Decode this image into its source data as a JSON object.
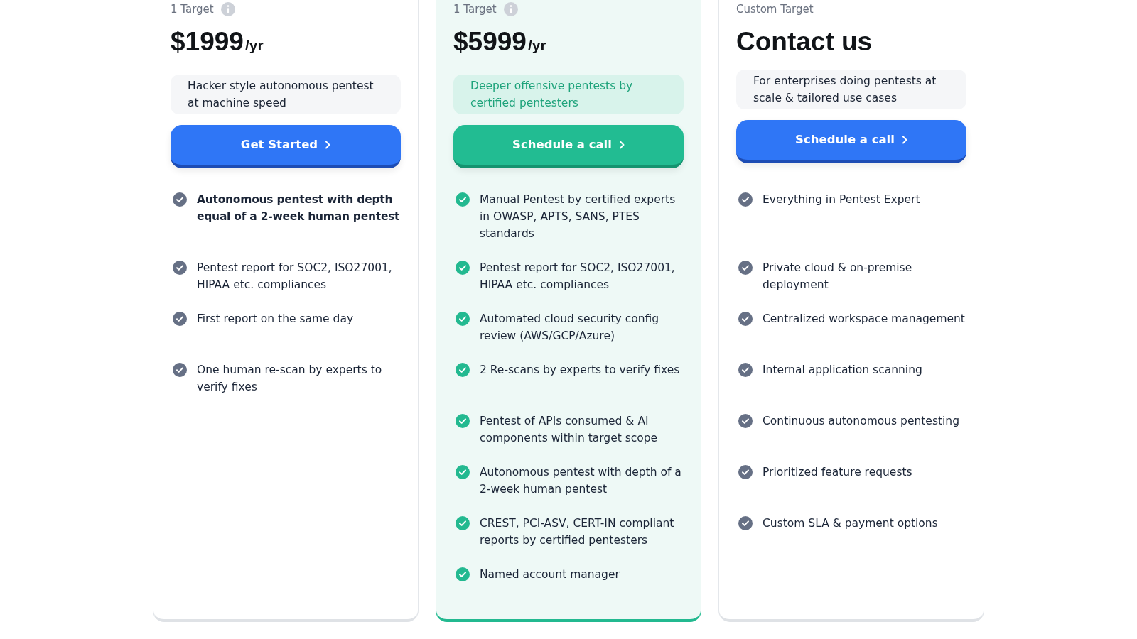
{
  "plans": [
    {
      "featured": false,
      "target": {
        "label": "1 Target",
        "info_icon": true
      },
      "header": {
        "kind": "price",
        "amount": "$1999",
        "period": "/yr"
      },
      "description": "Hacker style autonomous pentest at machine speed",
      "button": "Get Started",
      "features": [
        {
          "text": "Autonomous pentest with depth equal of a 2-week human pentest",
          "bold": true
        },
        {
          "text": "Pentest report for SOC2, ISO27001, HIPAA etc. compliances",
          "bold": false
        },
        {
          "text": "First report on the same day",
          "bold": false
        },
        {
          "text": "One human re-scan by experts to verify fixes",
          "bold": false
        }
      ]
    },
    {
      "featured": true,
      "target": {
        "label": "1 Target",
        "info_icon": true
      },
      "header": {
        "kind": "price",
        "amount": "$5999",
        "period": "/yr"
      },
      "description": "Deeper offensive pentests by certified pentesters",
      "button": "Schedule a call",
      "features": [
        {
          "text": "Manual Pentest by certified experts in OWASP, APTS, SANS, PTES standards",
          "bold": false
        },
        {
          "text": "Pentest report for SOC2, ISO27001, HIPAA etc. compliances",
          "bold": false
        },
        {
          "text": "Automated cloud security config review (AWS/GCP/Azure)",
          "bold": false
        },
        {
          "text": "2 Re-scans by experts to verify fixes",
          "bold": false
        },
        {
          "text": "Pentest of APIs consumed & AI components within target scope",
          "bold": false
        },
        {
          "text": "Autonomous pentest with depth of a 2-week human pentest",
          "bold": false
        },
        {
          "text": "CREST, PCI-ASV, CERT-IN compliant reports by certified pentesters",
          "bold": false
        },
        {
          "text": "Named account manager",
          "bold": false
        }
      ]
    },
    {
      "featured": false,
      "target": {
        "label": "Custom Target",
        "info_icon": false
      },
      "header": {
        "kind": "title",
        "text": "Contact us"
      },
      "description": "For enterprises doing pentests at scale & tailored use cases",
      "button": "Schedule a call",
      "features": [
        {
          "text": "Everything in Pentest Expert",
          "bold": false
        },
        {
          "text": "Private cloud & on-premise deployment",
          "bold": false
        },
        {
          "text": "Centralized workspace management",
          "bold": false
        },
        {
          "text": "Internal application scanning",
          "bold": false
        },
        {
          "text": "Continuous autonomous pentesting",
          "bold": false
        },
        {
          "text": "Prioritized feature requests",
          "bold": false
        },
        {
          "text": "Custom SLA & payment options",
          "bold": false
        }
      ]
    }
  ]
}
